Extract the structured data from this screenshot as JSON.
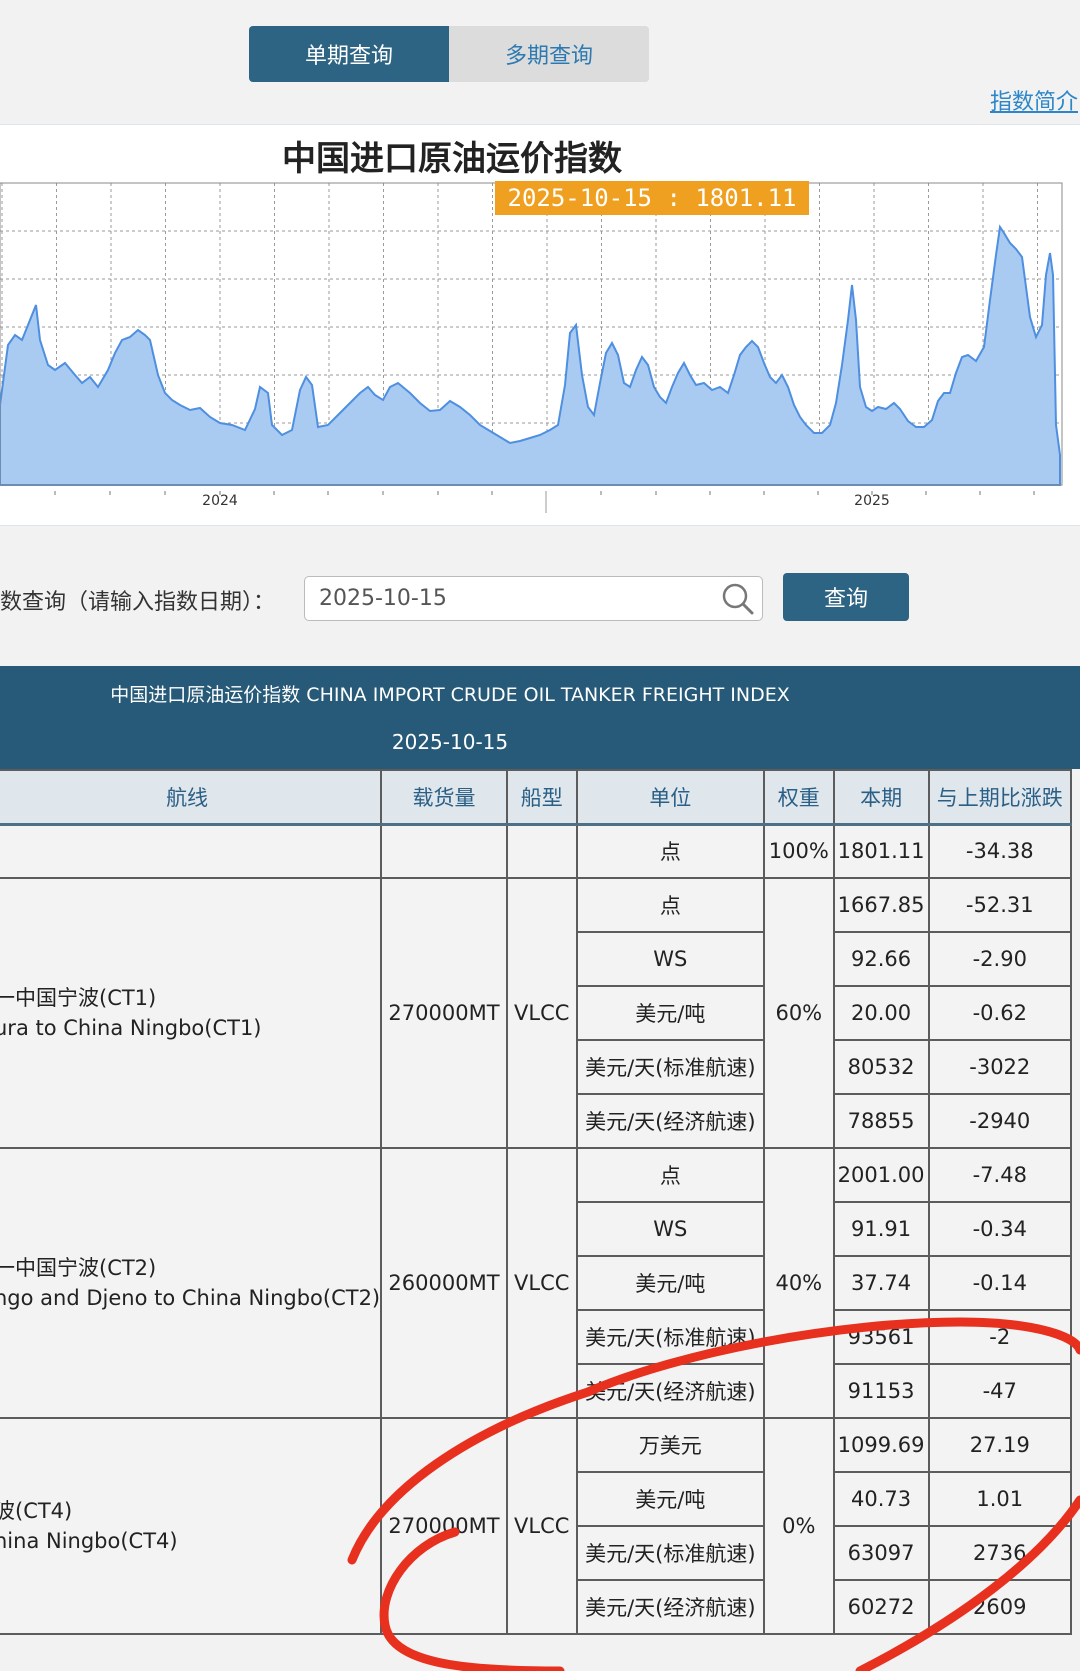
{
  "toolbar": {
    "single_period": "单期查询",
    "multi_period": "多期查询",
    "index_intro": "指数简介"
  },
  "chart_data": {
    "type": "area",
    "title": "中国进口原油运价指数",
    "tooltip": "2025-10-15 : 1801.11",
    "x_tick_labels": [
      "2024",
      "2025"
    ],
    "grid": true,
    "fill_color": "#a9cbf2",
    "line_color": "#4e8fe0"
  },
  "search": {
    "label": "数查询（请输入指数日期）：",
    "value": "2025-10-15",
    "button": "查询"
  },
  "table": {
    "band_title": "中国进口原油运价指数 CHINA IMPORT CRUDE OIL TANKER FREIGHT INDEX",
    "band_date": "2025-10-15",
    "headers": [
      "航线",
      "载货量",
      "船型",
      "单位",
      "权重",
      "本期",
      "与上期比涨跌"
    ],
    "overall": {
      "unit": "点",
      "weight": "100%",
      "current": "1801.11",
      "change": "-34.38"
    },
    "groups": [
      {
        "route_cn": "一中国宁波(CT1)",
        "route_en": "ura to China Ningbo(CT1)",
        "capacity": "270000MT",
        "ship": "VLCC",
        "weight": "60%",
        "rows": [
          {
            "unit": "点",
            "current": "1667.85",
            "change": "-52.31"
          },
          {
            "unit": "WS",
            "current": "92.66",
            "change": "-2.90"
          },
          {
            "unit": "美元/吨",
            "current": "20.00",
            "change": "-0.62"
          },
          {
            "unit": "美元/天(标准航速)",
            "current": "80532",
            "change": "-3022"
          },
          {
            "unit": "美元/天(经济航速)",
            "current": "78855",
            "change": "-2940"
          }
        ]
      },
      {
        "route_cn": "一中国宁波(CT2)",
        "route_en": "ngo and Djeno to China Ningbo(CT2)",
        "capacity": "260000MT",
        "ship": "VLCC",
        "weight": "40%",
        "rows": [
          {
            "unit": "点",
            "current": "2001.00",
            "change": "-7.48"
          },
          {
            "unit": "WS",
            "current": "91.91",
            "change": "-0.34"
          },
          {
            "unit": "美元/吨",
            "current": "37.74",
            "change": "-0.14"
          },
          {
            "unit": "美元/天(标准航速)",
            "current": "93561",
            "change": "-2"
          },
          {
            "unit": "美元/天(经济航速)",
            "current": "91153",
            "change": "-47"
          }
        ]
      },
      {
        "route_cn": "波(CT4)",
        "route_en": "hina Ningbo(CT4)",
        "capacity": "270000MT",
        "ship": "VLCC",
        "weight": "0%",
        "rows": [
          {
            "unit": "万美元",
            "current": "1099.69",
            "change": "27.19"
          },
          {
            "unit": "美元/吨",
            "current": "40.73",
            "change": "1.01"
          },
          {
            "unit": "美元/天(标准航速)",
            "current": "63097",
            "change": "2736"
          },
          {
            "unit": "美元/天(经济航速)",
            "current": "60272",
            "change": "2609"
          }
        ]
      }
    ]
  }
}
